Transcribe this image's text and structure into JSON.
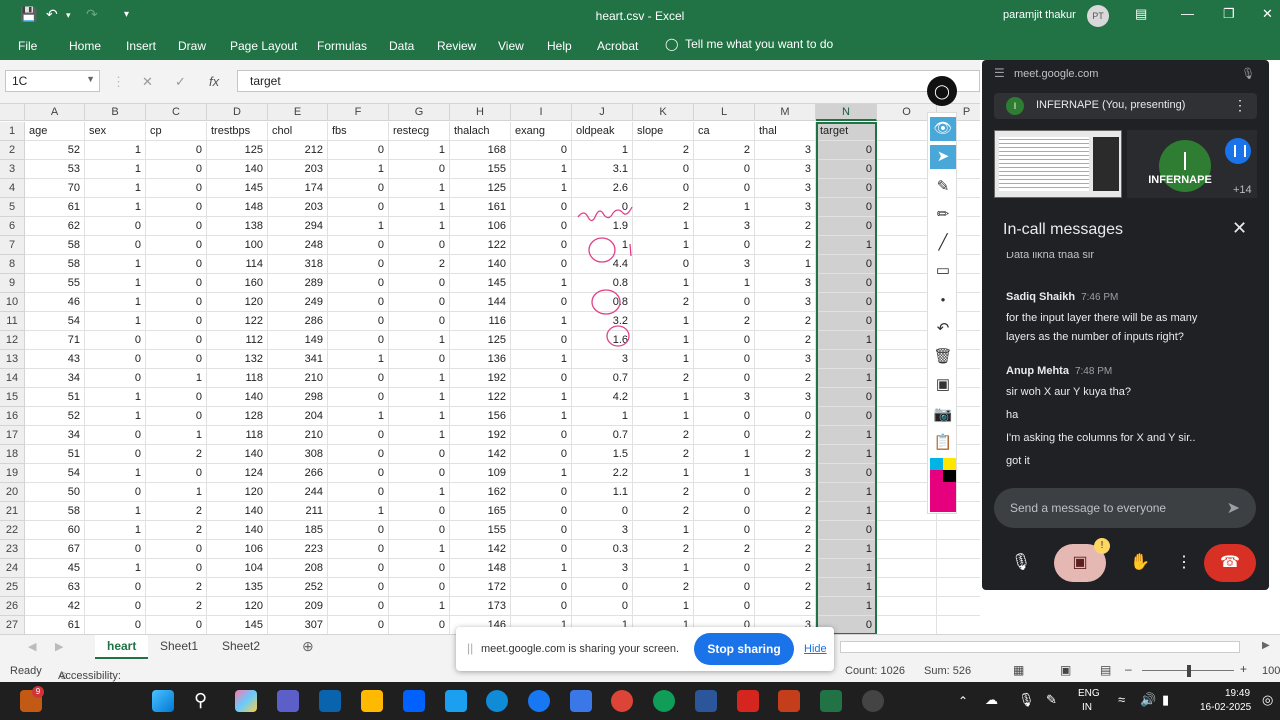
{
  "window": {
    "title": "heart.csv - Excel",
    "user": "paramjit thakur",
    "user_initials": "PT"
  },
  "ribbon_tabs": [
    "File",
    "Home",
    "Insert",
    "Draw",
    "Page Layout",
    "Formulas",
    "Data",
    "Review",
    "View",
    "Help",
    "Acrobat"
  ],
  "tell_me": "Tell me what you want to do",
  "name_box": "1C",
  "formula_value": "target",
  "columns": [
    "A",
    "B",
    "C",
    "D",
    "E",
    "F",
    "G",
    "H",
    "I",
    "J",
    "K",
    "L",
    "M",
    "N",
    "O",
    "P"
  ],
  "header_row": [
    "age",
    "sex",
    "cp",
    "trestbps",
    "chol",
    "fbs",
    "restecg",
    "thalach",
    "exang",
    "oldpeak",
    "slope",
    "ca",
    "thal",
    "target"
  ],
  "rows": [
    [
      "52",
      "1",
      "0",
      "125",
      "212",
      "0",
      "1",
      "168",
      "0",
      "1",
      "2",
      "2",
      "3",
      "0"
    ],
    [
      "53",
      "1",
      "0",
      "140",
      "203",
      "1",
      "0",
      "155",
      "1",
      "3.1",
      "0",
      "0",
      "3",
      "0"
    ],
    [
      "70",
      "1",
      "0",
      "145",
      "174",
      "0",
      "1",
      "125",
      "1",
      "2.6",
      "0",
      "0",
      "3",
      "0"
    ],
    [
      "61",
      "1",
      "0",
      "148",
      "203",
      "0",
      "1",
      "161",
      "0",
      "0",
      "2",
      "1",
      "3",
      "0"
    ],
    [
      "62",
      "0",
      "0",
      "138",
      "294",
      "1",
      "1",
      "106",
      "0",
      "1.9",
      "1",
      "3",
      "2",
      "0"
    ],
    [
      "58",
      "0",
      "0",
      "100",
      "248",
      "0",
      "0",
      "122",
      "0",
      "1",
      "1",
      "0",
      "2",
      "1"
    ],
    [
      "58",
      "1",
      "0",
      "114",
      "318",
      "0",
      "2",
      "140",
      "0",
      "4.4",
      "0",
      "3",
      "1",
      "0"
    ],
    [
      "55",
      "1",
      "0",
      "160",
      "289",
      "0",
      "0",
      "145",
      "1",
      "0.8",
      "1",
      "1",
      "3",
      "0"
    ],
    [
      "46",
      "1",
      "0",
      "120",
      "249",
      "0",
      "0",
      "144",
      "0",
      "0.8",
      "2",
      "0",
      "3",
      "0"
    ],
    [
      "54",
      "1",
      "0",
      "122",
      "286",
      "0",
      "0",
      "116",
      "1",
      "3.2",
      "1",
      "2",
      "2",
      "0"
    ],
    [
      "71",
      "0",
      "0",
      "112",
      "149",
      "0",
      "1",
      "125",
      "0",
      "1.6",
      "1",
      "0",
      "2",
      "1"
    ],
    [
      "43",
      "0",
      "0",
      "132",
      "341",
      "1",
      "0",
      "136",
      "1",
      "3",
      "1",
      "0",
      "3",
      "0"
    ],
    [
      "34",
      "0",
      "1",
      "118",
      "210",
      "0",
      "1",
      "192",
      "0",
      "0.7",
      "2",
      "0",
      "2",
      "1"
    ],
    [
      "51",
      "1",
      "0",
      "140",
      "298",
      "0",
      "1",
      "122",
      "1",
      "4.2",
      "1",
      "3",
      "3",
      "0"
    ],
    [
      "52",
      "1",
      "0",
      "128",
      "204",
      "1",
      "1",
      "156",
      "1",
      "1",
      "1",
      "0",
      "0",
      "0"
    ],
    [
      "34",
      "0",
      "1",
      "118",
      "210",
      "0",
      "1",
      "192",
      "0",
      "0.7",
      "2",
      "0",
      "2",
      "1"
    ],
    [
      "51",
      "0",
      "2",
      "140",
      "308",
      "0",
      "0",
      "142",
      "0",
      "1.5",
      "2",
      "1",
      "2",
      "1"
    ],
    [
      "54",
      "1",
      "0",
      "124",
      "266",
      "0",
      "0",
      "109",
      "1",
      "2.2",
      "1",
      "1",
      "3",
      "0"
    ],
    [
      "50",
      "0",
      "1",
      "120",
      "244",
      "0",
      "1",
      "162",
      "0",
      "1.1",
      "2",
      "0",
      "2",
      "1"
    ],
    [
      "58",
      "1",
      "2",
      "140",
      "211",
      "1",
      "0",
      "165",
      "0",
      "0",
      "2",
      "0",
      "2",
      "1"
    ],
    [
      "60",
      "1",
      "2",
      "140",
      "185",
      "0",
      "0",
      "155",
      "0",
      "3",
      "1",
      "0",
      "2",
      "0"
    ],
    [
      "67",
      "0",
      "0",
      "106",
      "223",
      "0",
      "1",
      "142",
      "0",
      "0.3",
      "2",
      "2",
      "2",
      "1"
    ],
    [
      "45",
      "1",
      "0",
      "104",
      "208",
      "0",
      "0",
      "148",
      "1",
      "3",
      "1",
      "0",
      "2",
      "1"
    ],
    [
      "63",
      "0",
      "2",
      "135",
      "252",
      "0",
      "0",
      "172",
      "0",
      "0",
      "2",
      "0",
      "2",
      "1"
    ],
    [
      "42",
      "0",
      "2",
      "120",
      "209",
      "0",
      "1",
      "173",
      "0",
      "0",
      "1",
      "0",
      "2",
      "1"
    ],
    [
      "61",
      "0",
      "0",
      "145",
      "307",
      "0",
      "0",
      "146",
      "1",
      "1",
      "1",
      "0",
      "3",
      "0"
    ]
  ],
  "sheet_tabs": [
    "heart",
    "Sheet1",
    "Sheet2"
  ],
  "status": {
    "ready": "Ready",
    "accessibility": "Accessibility: Unavailable",
    "count": "Count: 1026",
    "sum": "Sum: 526",
    "zoom": "100"
  },
  "share_bar": {
    "text": "meet.google.com is sharing your screen.",
    "stop": "Stop sharing",
    "hide": "Hide"
  },
  "meet": {
    "url": "meet.google.com",
    "presenting": "INFERNAPE (You, presenting)",
    "presenter_initial": "I",
    "tile_name": "INFERNAPE",
    "participant_count": "+14",
    "chat_title": "In-call messages",
    "messages": [
      {
        "kind": "text",
        "text": "Data likha thaa sir"
      },
      {
        "kind": "name",
        "name": "Sadiq Shaikh",
        "time": "7:46 PM"
      },
      {
        "kind": "text",
        "text": "for the input layer there will be as many"
      },
      {
        "kind": "text",
        "text": "layers as the number of inputs right?"
      },
      {
        "kind": "name",
        "name": "Anup Mehta",
        "time": "7:48 PM"
      },
      {
        "kind": "text",
        "text": "sir woh X aur Y kuya tha?"
      },
      {
        "kind": "text",
        "text": "ha"
      },
      {
        "kind": "text",
        "text": "I'm asking the columns for X and Y sir.."
      },
      {
        "kind": "text",
        "text": "got it"
      }
    ],
    "input_placeholder": "Send a message to everyone",
    "end_color": "#d93025",
    "accent_color": "#1a73e8"
  },
  "taskbar": {
    "lang1": "ENG",
    "lang2": "IN",
    "time": "19:49",
    "date": "16-02-2025",
    "badge": "9"
  },
  "colors": {
    "excel_green": "#217346",
    "ink": "#e0408a"
  }
}
